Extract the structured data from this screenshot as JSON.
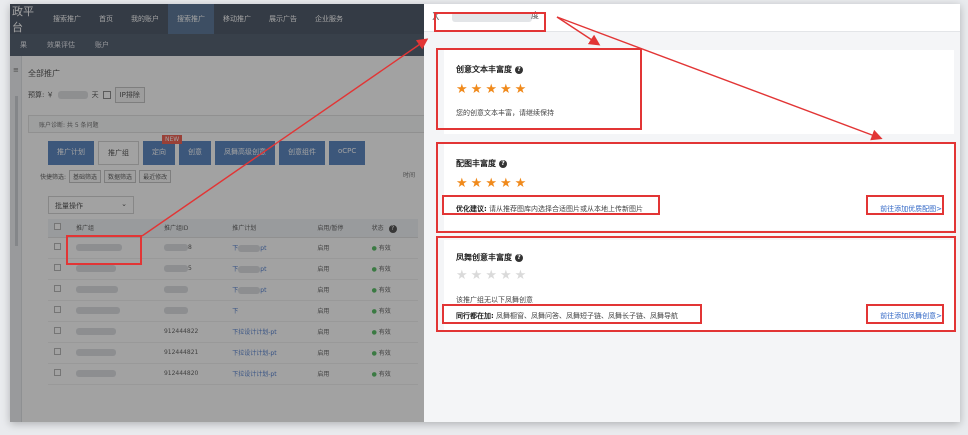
{
  "app": {
    "logo": "政平台",
    "top_nav": [
      "搜索推广",
      "首页",
      "我的账户",
      "搜索推广",
      "移动推广",
      "展示广告",
      "企业服务"
    ],
    "top_nav_active": 3,
    "sub_nav": [
      "果",
      "效果评估",
      "账户"
    ],
    "all_plans": "全部推广",
    "budget_label": "预算: ￥",
    "budget_suffix": "天",
    "exclude_ip": "IP排除",
    "diagnosis": "账户诊断: 共 5 条问题",
    "tabs": [
      "推广计划",
      "推广组",
      "定向",
      "创意",
      "凤舞高级创意",
      "创意组件",
      "oCPC"
    ],
    "tabs_active": 1,
    "new_badge": "NEW",
    "quick_filter_label": "快捷筛选:",
    "quick_filters": [
      "基础筛选",
      "数据筛选",
      "最近修改"
    ],
    "right_label": "时间",
    "batch_label": "批量操作",
    "table_headers": [
      "",
      "推广组",
      "推广组ID",
      "推广计划",
      "启用/暂停",
      "状态"
    ],
    "rows": [
      {
        "id_text": "8",
        "plan": "下",
        "plan_suffix": "pt",
        "enable": "启用",
        "status": "有效"
      },
      {
        "id_text": "5",
        "plan": "下",
        "plan_suffix": "pt",
        "enable": "启用",
        "status": "有效"
      },
      {
        "id_text": "",
        "plan": "下",
        "plan_suffix": "pt",
        "enable": "启用",
        "status": "有效"
      },
      {
        "id_text": "",
        "plan": "下",
        "plan_suffix": "",
        "enable": "启用",
        "status": "有效"
      },
      {
        "id_text": "912444822",
        "plan": "下拉设计计划-pt",
        "plan_suffix": "",
        "enable": "启用",
        "status": "有效"
      },
      {
        "id_text": "912444821",
        "plan": "下拉设计计划-pt",
        "plan_suffix": "",
        "enable": "启用",
        "status": "有效"
      },
      {
        "id_text": "912444820",
        "plan": "下拉设计计划-pt",
        "plan_suffix": "",
        "enable": "启用",
        "status": "有效"
      }
    ]
  },
  "panel": {
    "close": "X",
    "title_suffix": "度",
    "cards": [
      {
        "title": "创意文本丰富度",
        "stars_filled": 5,
        "stars_total": 5,
        "desc_label": "",
        "desc": "您的创意文本丰富，请继续保持",
        "link": ""
      },
      {
        "title": "配图丰富度",
        "stars_filled": 5,
        "stars_total": 5,
        "desc_label": "优化建议:",
        "desc": "请从推荐图库内选择合适图片或从本地上传新图片",
        "link": "前往添加优质配图>"
      },
      {
        "title": "凤舞创意丰富度",
        "stars_filled": 0,
        "stars_total": 5,
        "desc_pre": "该推广组无以下凤舞创意",
        "desc_label": "同行都在加:",
        "desc": "凤舞橱窗、凤舞问答、凤舞短子链、凤舞长子链、凤舞导航",
        "link": "前往添加凤舞创意>"
      }
    ]
  },
  "colors": {
    "annotation": "#e23535",
    "star_on": "#f08a1c",
    "link": "#2f65c5",
    "nav_bg": "#2d3a4d"
  }
}
